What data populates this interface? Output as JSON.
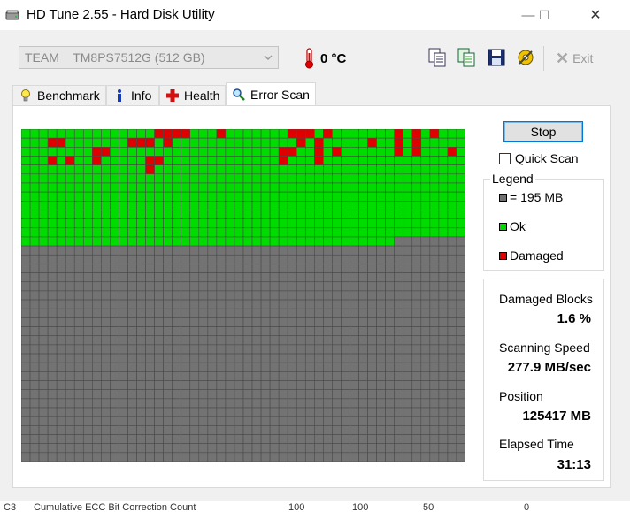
{
  "window": {
    "title": "HD Tune 2.55 - Hard Disk Utility",
    "minimize_glyph": "—",
    "maximize_glyph": "☐",
    "close_glyph": "✕"
  },
  "toolbar": {
    "drive_label": "TEAM    TM8PS7512G (512 GB)",
    "temperature": "0 °C",
    "icons": [
      "copy-text-icon",
      "copy-info-icon",
      "save-icon",
      "options-icon"
    ],
    "exit_glyph": "✕",
    "exit_label": "Exit"
  },
  "tabs": [
    {
      "label": "Benchmark",
      "icon": "benchmark-bulb-icon"
    },
    {
      "label": "Info",
      "icon": "info-icon"
    },
    {
      "label": "Health",
      "icon": "health-cross-icon"
    },
    {
      "label": "Error Scan",
      "icon": "magnifier-icon",
      "active": true
    }
  ],
  "error_scan": {
    "stop_label": "Stop",
    "quick_scan_label": "Quick Scan",
    "quick_scan_checked": false,
    "legend_title": "Legend",
    "legend": [
      {
        "label": "= 195 MB",
        "color": "#707070"
      },
      {
        "label": "Ok",
        "color": "#00d800"
      },
      {
        "label": "Damaged",
        "color": "#e00000"
      }
    ],
    "stats": [
      {
        "label": "Damaged Blocks",
        "value": "1.6 %"
      },
      {
        "label": "Scanning Speed",
        "value": "277.9 MB/sec"
      },
      {
        "label": "Position",
        "value": "125417 MB"
      },
      {
        "label": "Elapsed Time",
        "value": "31:13"
      }
    ],
    "block_grid": {
      "columns": 50,
      "rows": 37,
      "ok_blocks": 642,
      "colors": {
        "ok": "#00dc00",
        "damaged": "#e00000",
        "pending": "#737373",
        "line": "#4a4a4a"
      },
      "damaged_cells": [
        [
          0,
          15
        ],
        [
          0,
          16
        ],
        [
          0,
          17
        ],
        [
          0,
          18
        ],
        [
          0,
          22
        ],
        [
          0,
          30
        ],
        [
          0,
          31
        ],
        [
          0,
          32
        ],
        [
          0,
          34
        ],
        [
          0,
          42
        ],
        [
          0,
          44
        ],
        [
          0,
          46
        ],
        [
          1,
          3
        ],
        [
          1,
          4
        ],
        [
          1,
          12
        ],
        [
          1,
          13
        ],
        [
          1,
          14
        ],
        [
          1,
          16
        ],
        [
          1,
          31
        ],
        [
          1,
          33
        ],
        [
          1,
          39
        ],
        [
          1,
          42
        ],
        [
          1,
          44
        ],
        [
          2,
          8
        ],
        [
          2,
          9
        ],
        [
          2,
          29
        ],
        [
          2,
          30
        ],
        [
          2,
          33
        ],
        [
          2,
          35
        ],
        [
          2,
          42
        ],
        [
          2,
          44
        ],
        [
          2,
          48
        ],
        [
          3,
          3
        ],
        [
          3,
          5
        ],
        [
          3,
          8
        ],
        [
          3,
          14
        ],
        [
          3,
          15
        ],
        [
          3,
          29
        ],
        [
          3,
          33
        ],
        [
          4,
          14
        ]
      ]
    }
  },
  "background_row": {
    "cells": [
      "C3",
      "Cumulative ECC Bit Correction Count",
      "100",
      "100",
      "50",
      "0"
    ]
  }
}
